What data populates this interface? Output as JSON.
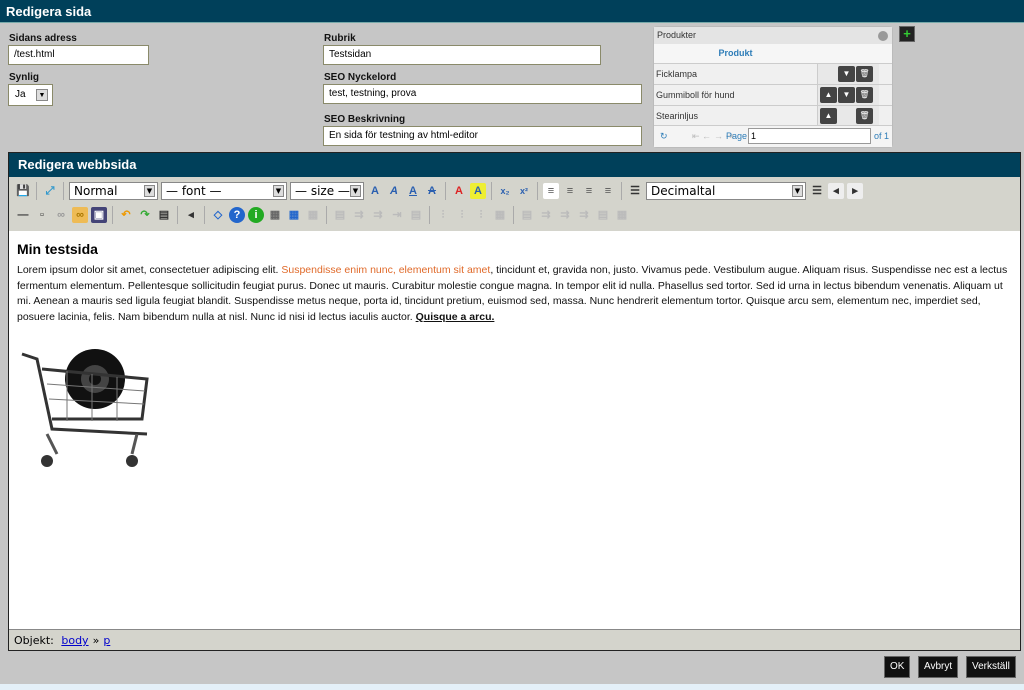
{
  "header": {
    "title": "Redigera sida"
  },
  "form": {
    "address_label": "Sidans adress",
    "address_value": "/test.html",
    "visible_label": "Synlig",
    "visible_value": "Ja",
    "title_label": "Rubrik",
    "title_value": "Testsidan",
    "keywords_label": "SEO Nyckelord",
    "keywords_value": "test, testning, prova",
    "description_label": "SEO Beskrivning",
    "description_value": "En sida för testning av html-editor"
  },
  "products": {
    "title": "Produkter",
    "column": "Produkt",
    "rows": [
      {
        "name": "Ficklampa"
      },
      {
        "name": "Gummiboll för hund"
      },
      {
        "name": "Stearinljus"
      }
    ],
    "page_label": "Page",
    "page_value": "1",
    "of_label": "of 1"
  },
  "editor": {
    "title": "Redigera webbsida",
    "format": "Normal",
    "font": "— font —",
    "size": "— size —",
    "list_style": "Decimaltal",
    "heading": "Min testsida",
    "p1": "Lorem ipsum dolor sit amet, consectetuer adipiscing elit. ",
    "p_orange": "Suspendisse enim nunc, elementum sit amet",
    "p2": ", tincidunt et, gravida non, justo. Vivamus pede. Vestibulum augue. Aliquam risus. Suspendisse nec est a lectus fermentum elementum. Pellentesque sollicitudin feugiat purus. Donec ut mauris. Curabitur molestie congue magna. In tempor elit id nulla. Phasellus sed tortor. Sed id urna in lectus bibendum venenatis. Aliquam ut mi. Aenean a mauris sed ligula feugiat blandit. Suspendisse metus neque, porta id, tincidunt pretium, euismod sed, massa. Nunc hendrerit elementum tortor. Quisque arcu sem, elementum nec, imperdiet sed, posuere lacinia, felis. Nam bibendum nulla at nisl. Nunc id nisi id lectus iaculis auctor. ",
    "p_bold": "Quisque a arcu.",
    "status_label": "Objekt:",
    "path": [
      "body",
      "p"
    ],
    "path_sep": "»"
  },
  "buttons": {
    "ok": "OK",
    "cancel": "Avbryt",
    "apply": "Verkställ"
  },
  "colors": {
    "header": "#00405a",
    "accent": "#2e7db8",
    "orange": "#e06a2a"
  }
}
